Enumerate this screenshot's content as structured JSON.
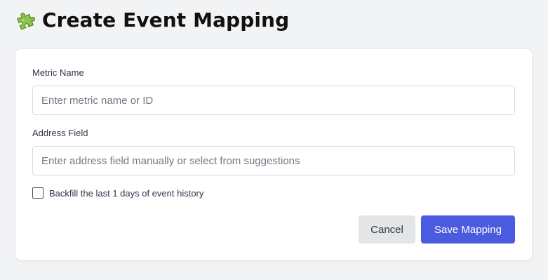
{
  "header": {
    "icon": "puzzle-piece-icon",
    "title": "Create Event Mapping"
  },
  "form": {
    "metric_name": {
      "label": "Metric Name",
      "value": "",
      "placeholder": "Enter metric name or ID"
    },
    "address_field": {
      "label": "Address Field",
      "value": "",
      "placeholder": "Enter address field manually or select from suggestions"
    },
    "backfill": {
      "label": "Backfill the last 1 days of event history",
      "checked": false
    }
  },
  "actions": {
    "cancel_label": "Cancel",
    "save_label": "Save Mapping"
  },
  "colors": {
    "primary": "#4a5be0",
    "page_background": "#f2f3f5",
    "puzzle_green": "#7cb342"
  }
}
